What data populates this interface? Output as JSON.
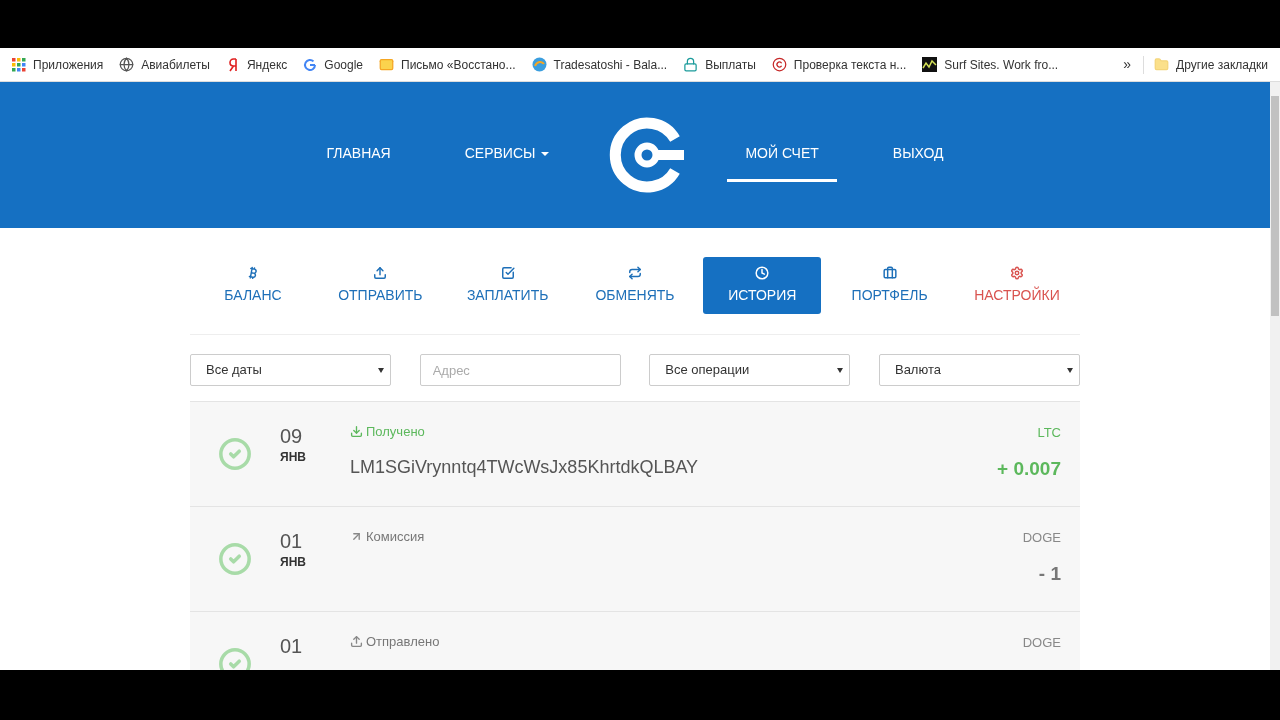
{
  "bookmarks": [
    {
      "label": "Приложения",
      "kind": "apps"
    },
    {
      "label": "Авиабилеты",
      "kind": "globe"
    },
    {
      "label": "Яндекс",
      "kind": "yandex"
    },
    {
      "label": "Google",
      "kind": "google"
    },
    {
      "label": "Письмо «Восстано...",
      "kind": "mail"
    },
    {
      "label": "Tradesatoshi - Bala...",
      "kind": "swirl"
    },
    {
      "label": "Выплаты",
      "kind": "lock"
    },
    {
      "label": "Проверка текста н...",
      "kind": "copyright"
    },
    {
      "label": "Surf Sites. Work fro...",
      "kind": "chart"
    }
  ],
  "bookmarks_overflow": "»",
  "other_bookmarks": "Другие закладки",
  "nav": [
    {
      "label": "ГЛАВНАЯ",
      "selected": false,
      "dropdown": false
    },
    {
      "label": "СЕРВИСЫ",
      "selected": false,
      "dropdown": true
    },
    {
      "label": "МОЙ СЧЕТ",
      "selected": true,
      "dropdown": false
    },
    {
      "label": "ВЫХОД",
      "selected": false,
      "dropdown": false
    }
  ],
  "tabs": [
    {
      "label": "БАЛАНС",
      "kind": "balance",
      "selected": false
    },
    {
      "label": "ОТПРАВИТЬ",
      "kind": "send",
      "selected": false
    },
    {
      "label": "ЗАПЛАТИТЬ",
      "kind": "pay",
      "selected": false
    },
    {
      "label": "ОБМЕНЯТЬ",
      "kind": "exchange",
      "selected": false
    },
    {
      "label": "ИСТОРИЯ",
      "kind": "history",
      "selected": true
    },
    {
      "label": "ПОРТФЕЛЬ",
      "kind": "wallet",
      "selected": false
    },
    {
      "label": "НАСТРОЙКИ",
      "kind": "settings",
      "selected": false
    }
  ],
  "filters": [
    {
      "kind": "select",
      "value": "Все даты"
    },
    {
      "kind": "input",
      "placeholder": "Адрес"
    },
    {
      "kind": "select",
      "value": "Все операции"
    },
    {
      "kind": "select",
      "value": "Валюта"
    }
  ],
  "transactions": [
    {
      "day": "09",
      "month": "ЯНВ",
      "kind": "received",
      "category": "Получено",
      "address": "LM1SGiVrynntq4TWcWsJx85KhrtdkQLBAY",
      "currency": "LTC",
      "amount": "+ 0.007"
    },
    {
      "day": "01",
      "month": "ЯНВ",
      "kind": "fee",
      "category": "Комиссия",
      "currency": "DOGE",
      "amount": "- 1"
    },
    {
      "day": "01",
      "kind": "sent",
      "category": "Отправлено",
      "currency": "DOGE"
    }
  ]
}
